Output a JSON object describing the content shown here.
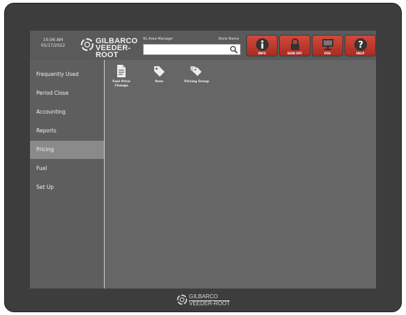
{
  "header": {
    "time": "10:06 AM",
    "date": "05/17/2022",
    "brand_line1": "GILBARCO",
    "brand_line2": "VEEDER-ROOT",
    "user": "91-Area Manager",
    "store": "Store Name",
    "search": {
      "value": "",
      "placeholder": ""
    },
    "buttons": [
      {
        "label": "INFO",
        "icon": "info-icon"
      },
      {
        "label": "SIGN OFF",
        "icon": "lock-icon"
      },
      {
        "label": "POS",
        "icon": "monitor-icon"
      },
      {
        "label": "HELP",
        "icon": "question-icon"
      }
    ]
  },
  "sidebar": {
    "items": [
      {
        "label": "Frequently Used"
      },
      {
        "label": "Period Close"
      },
      {
        "label": "Accounting"
      },
      {
        "label": "Reports"
      },
      {
        "label": "Pricing",
        "active": true
      },
      {
        "label": "Fuel"
      },
      {
        "label": "Set Up"
      }
    ]
  },
  "main": {
    "tiles": [
      {
        "label": "Fuel Price Change",
        "icon": "document-icon"
      },
      {
        "label": "Item",
        "icon": "tag-icon"
      },
      {
        "label": "Pricing Group",
        "icon": "tags-group-icon"
      }
    ]
  },
  "footer": {
    "brand_line1": "GILBARCO",
    "brand_line2": "VEEDER-ROOT"
  },
  "colors": {
    "accent_button": "#c0392b",
    "active_nav": "#8a8a8a",
    "screen_bg": "#666666"
  }
}
